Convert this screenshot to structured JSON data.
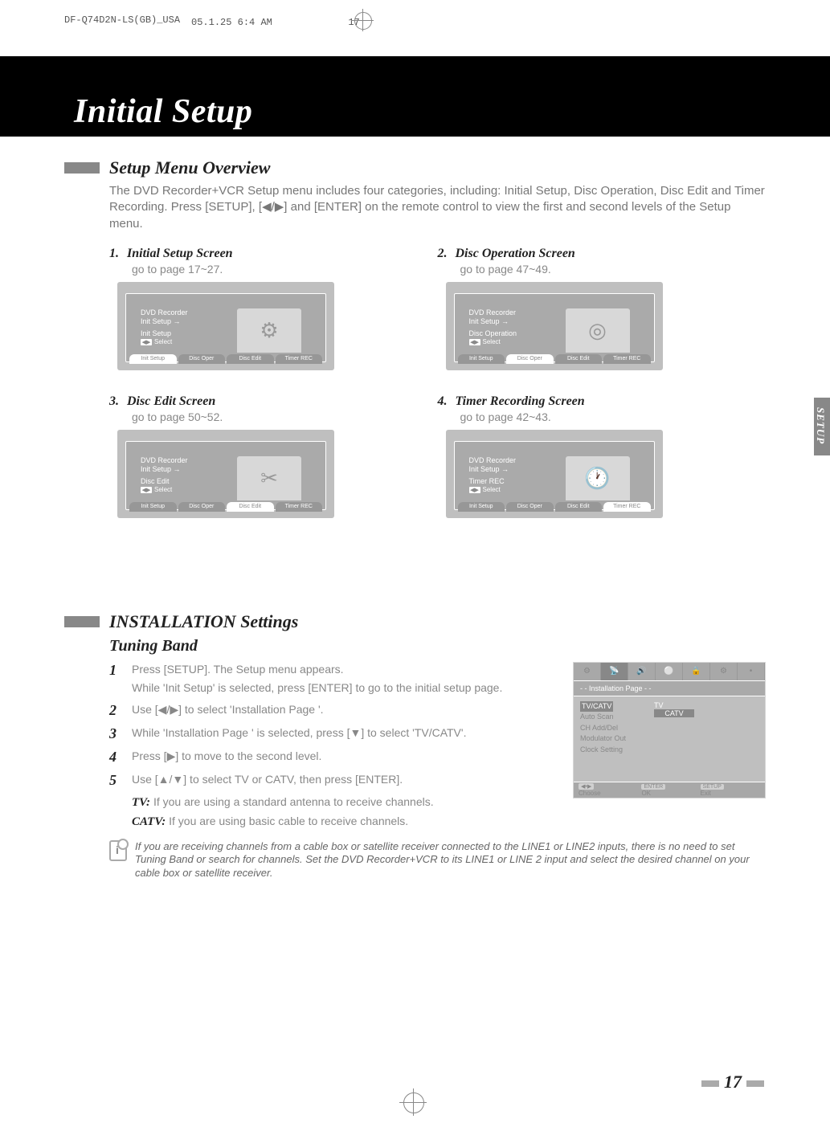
{
  "print": {
    "file": "DF-Q74D2N-LS(GB)_USA",
    "ts": "05.1.25 6:4 AM",
    "page": "17"
  },
  "page_title": "Initial Setup",
  "overview": {
    "heading": "Setup Menu Overview",
    "intro": "The DVD Recorder+VCR Setup menu includes four categories, including: Initial Setup, Disc Operation, Disc Edit and Timer Recording. Press [SETUP], [◀/▶] and [ENTER] on the remote control to view the first and second levels of the Setup menu."
  },
  "screens": [
    {
      "num": "1.",
      "title": "Initial Setup Screen",
      "sub": "go to page 17~27.",
      "line1": "DVD Recorder",
      "line2": "Init Setup  →",
      "line3": "Init Setup",
      "sel": "Select",
      "tabs": [
        "Init Setup",
        "Disc Oper",
        "Disc Edit",
        "Timer REC"
      ],
      "active": 0
    },
    {
      "num": "2.",
      "title": "Disc Operation Screen",
      "sub": "go to page 47~49.",
      "line1": "DVD Recorder",
      "line2": "Init Setup  →",
      "line3": "Disc Operation",
      "sel": "Select",
      "tabs": [
        "Init Setup",
        "Disc Oper",
        "Disc Edit",
        "Timer REC"
      ],
      "active": 1
    },
    {
      "num": "3.",
      "title": "Disc Edit Screen",
      "sub": "go to page 50~52.",
      "line1": "DVD Recorder",
      "line2": "Init Setup  →",
      "line3": "Disc Edit",
      "sel": "Select",
      "tabs": [
        "Init Setup",
        "Disc Oper",
        "Disc Edit",
        "Timer REC"
      ],
      "active": 2
    },
    {
      "num": "4.",
      "title": "Timer Recording Screen",
      "sub": "go to page 42~43.",
      "line1": "DVD Recorder",
      "line2": "Init Setup  →",
      "line3": "Timer REC",
      "sel": "Select",
      "tabs": [
        "Init Setup",
        "Disc Oper",
        "Disc Edit",
        "Timer REC"
      ],
      "active": 3
    }
  ],
  "install": {
    "heading": "INSTALLATION Settings",
    "sub": "Tuning Band",
    "steps": [
      {
        "n": "1",
        "t": "Press [SETUP]. The Setup menu appears.",
        "c": "While 'Init Setup' is selected, press [ENTER] to go to the initial setup page."
      },
      {
        "n": "2",
        "t": "Use [◀/▶] to select 'Installation Page        '."
      },
      {
        "n": "3",
        "t": "While 'Installation Page        ' is selected, press [▼] to select 'TV/CATV'."
      },
      {
        "n": "4",
        "t": "Press [▶] to move to the second level."
      },
      {
        "n": "5",
        "t": "Use [▲/▼] to select TV or CATV, then press [ENTER]."
      }
    ],
    "tv": {
      "label": "TV:",
      "text": "If you are using a standard antenna to receive channels."
    },
    "catv": {
      "label": "CATV:",
      "text": "If you are using basic cable to receive channels."
    },
    "note": "If you are receiving channels from a cable box or satellite receiver connected to the LINE1 or LINE2 inputs, there is no need to set Tuning Band or search for channels. Set the DVD Recorder+VCR to its LINE1 or LINE 2 input and select the desired channel on your cable box or satellite receiver.",
    "panel": {
      "title": "- - Installation Page - -",
      "items": [
        "TV/CATV",
        "Auto Scan",
        "CH Add/Del",
        "Modulator Out",
        "Clock Setting"
      ],
      "opt1": "TV",
      "opt2": "CATV",
      "foot_choose": "Choose",
      "foot_ok": "OK",
      "foot_exit": "Exit",
      "btn_arrows": "◀•▶",
      "btn_enter": "ENTER",
      "btn_setup": "SETUP"
    }
  },
  "side_tab": "SETUP",
  "page_number": "17"
}
